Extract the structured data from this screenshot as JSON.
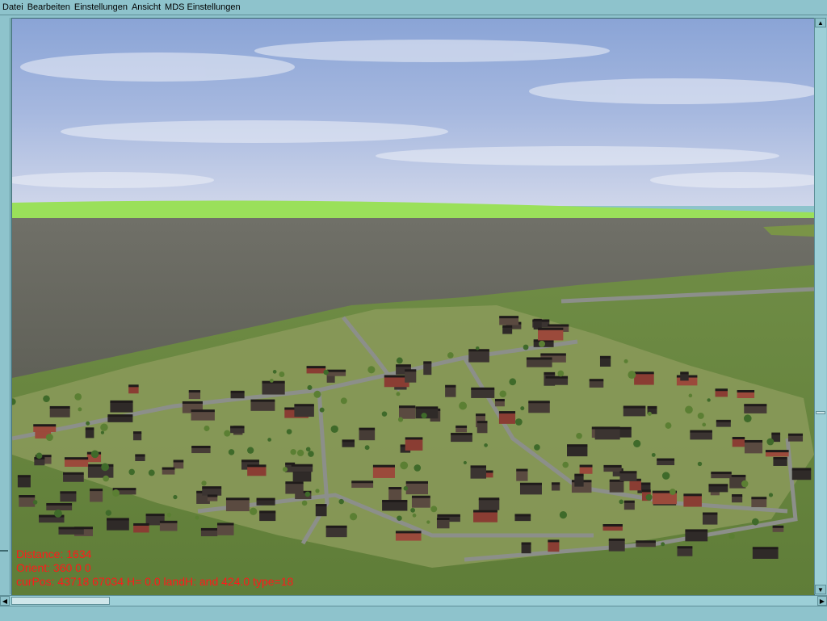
{
  "menu": {
    "items": [
      {
        "label": "Datei"
      },
      {
        "label": "Bearbeiten"
      },
      {
        "label": "Einstellungen"
      },
      {
        "label": "Ansicht"
      },
      {
        "label": "MDS Einstellungen"
      }
    ]
  },
  "hud": {
    "distance": "Distance: 1634",
    "orient": "Orient: 360 0 0",
    "curpos": "curPos: 43718 67034 H= 0.0 landH: and 424.0 type=18"
  },
  "colors": {
    "hud_text": "#ff1a1a",
    "window_chrome": "#8ec3cc",
    "sky": "#7f9bd6",
    "water": "#6b6b63",
    "grass": "#6f8a3e",
    "horizon_green": "#9ae05a"
  }
}
